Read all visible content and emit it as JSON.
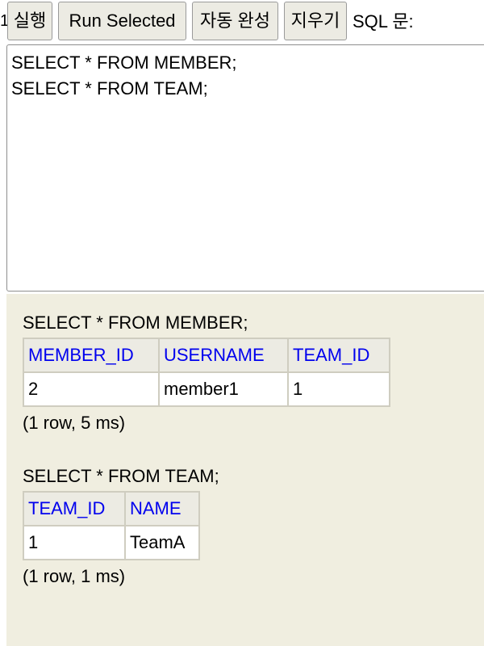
{
  "toolbar": {
    "cut_glyph": "1",
    "buttons": {
      "run": "실행",
      "run_selected": "Run Selected",
      "auto_complete": "자동 완성",
      "clear": "지우기"
    },
    "sql_label": "SQL 문:"
  },
  "editor": {
    "value": "SELECT * FROM MEMBER;\nSELECT * FROM TEAM;"
  },
  "results": [
    {
      "sql": "SELECT * FROM MEMBER;",
      "columns": [
        "MEMBER_ID",
        "USERNAME",
        "TEAM_ID"
      ],
      "rows": [
        [
          "2",
          "member1",
          "1"
        ]
      ],
      "status": "(1 row, 5 ms)"
    },
    {
      "sql": "SELECT * FROM TEAM;",
      "columns": [
        "TEAM_ID",
        "NAME"
      ],
      "rows": [
        [
          "1",
          "TeamA"
        ]
      ],
      "status": "(1 row, 1 ms)"
    }
  ]
}
